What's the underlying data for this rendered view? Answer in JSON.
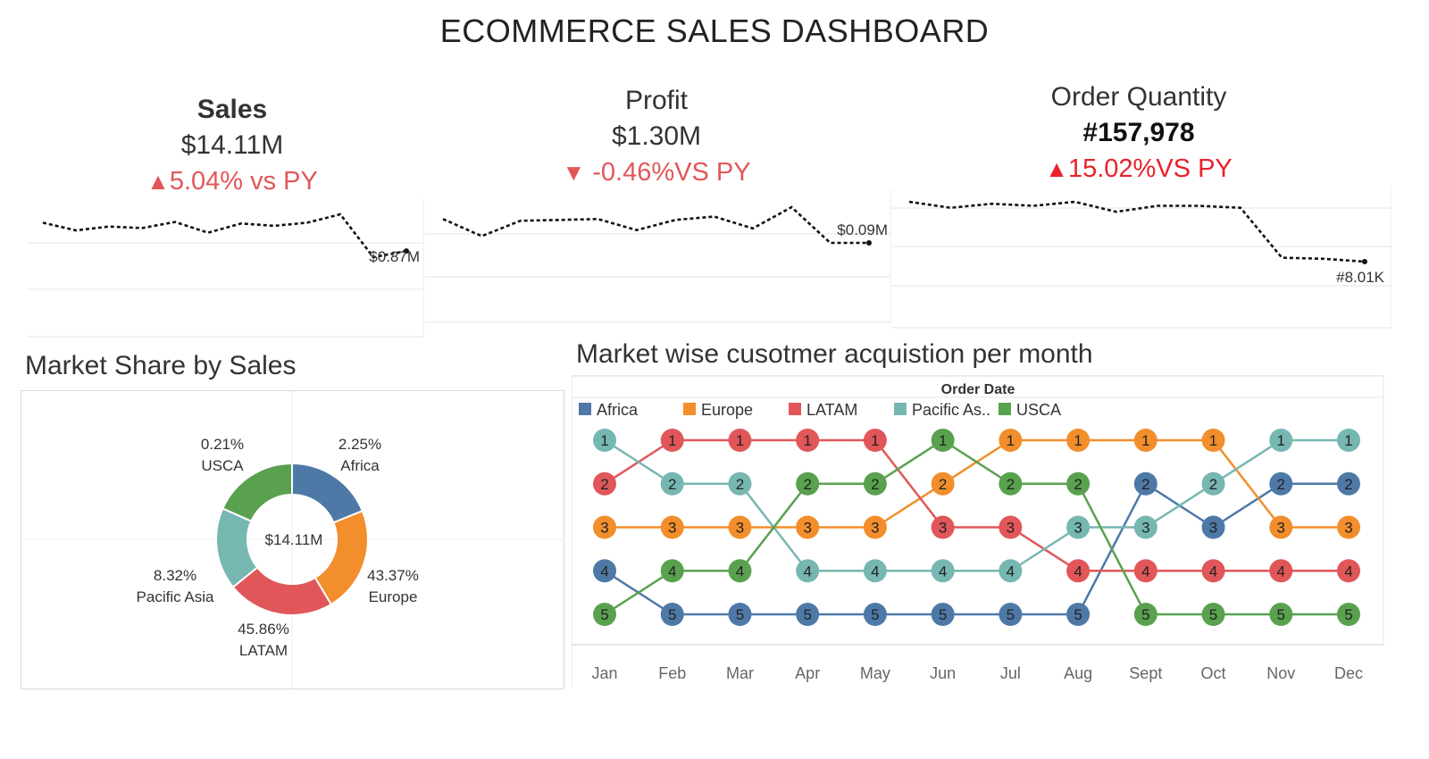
{
  "dashboard": {
    "title": "ECOMMERCE SALES DASHBOARD"
  },
  "kpis": {
    "sales": {
      "title": "Sales",
      "value": "$14.11M",
      "change": "5.04% vs PY",
      "arrow": "▲",
      "color": "#e15759"
    },
    "profit": {
      "title": "Profit",
      "value": "$1.30M",
      "change": "-0.46%VS PY",
      "arrow": "▼",
      "color": "#e15759"
    },
    "quantity": {
      "title": "Order Quantity",
      "value": "#157,978",
      "change": "15.02%VS PY",
      "arrow": "▲",
      "color": "#e8212b"
    }
  },
  "sections": {
    "market_share": {
      "title": "Market Share by Sales"
    },
    "acquisition": {
      "title": "Market wise cusotmer acquistion per month"
    }
  },
  "chart_data": [
    {
      "type": "line",
      "id": "sales-sparkline",
      "x": [
        "Jan",
        "Feb",
        "Mar",
        "Apr",
        "May",
        "Jun",
        "Jul",
        "Aug",
        "Sept",
        "Oct",
        "Nov",
        "Dec"
      ],
      "values": [
        1.24,
        1.14,
        1.19,
        1.17,
        1.25,
        1.11,
        1.23,
        1.2,
        1.24,
        1.35,
        0.79,
        0.87
      ],
      "end_label": "$0.87M",
      "grid": true
    },
    {
      "type": "line",
      "id": "profit-sparkline",
      "x": [
        "Jan",
        "Feb",
        "Mar",
        "Apr",
        "May",
        "Jun",
        "Jul",
        "Aug",
        "Sept",
        "Oct",
        "Nov",
        "Dec"
      ],
      "values": [
        0.118,
        0.098,
        0.116,
        0.117,
        0.118,
        0.105,
        0.117,
        0.121,
        0.107,
        0.132,
        0.09,
        0.09
      ],
      "end_label": "$0.09M",
      "grid": true
    },
    {
      "type": "line",
      "id": "quantity-sparkline",
      "x": [
        "Jan",
        "Feb",
        "Mar",
        "Apr",
        "May",
        "Jun",
        "Jul",
        "Aug",
        "Sept",
        "Oct",
        "Nov",
        "Dec"
      ],
      "values": [
        14.0,
        13.4,
        13.8,
        13.6,
        14.0,
        13.0,
        13.6,
        13.6,
        13.4,
        8.4,
        8.3,
        8.01
      ],
      "end_label": "#8.01K",
      "grid": true
    },
    {
      "type": "pie",
      "id": "market-share-donut",
      "center_label": "$14.11M",
      "slices": [
        {
          "name": "Africa",
          "pct_label": "2.25%",
          "value": 2.25,
          "color": "#4e79a7"
        },
        {
          "name": "Europe",
          "pct_label": "43.37%",
          "value": 43.37,
          "color": "#f28e2b"
        },
        {
          "name": "LATAM",
          "pct_label": "45.86%",
          "value": 45.86,
          "color": "#e15759"
        },
        {
          "name": "Pacific Asia",
          "pct_label": "8.32%",
          "value": 8.32,
          "color": "#76b7b2"
        },
        {
          "name": "USCA",
          "pct_label": "0.21%",
          "value": 0.21,
          "color": "#59a14f"
        }
      ]
    },
    {
      "type": "line",
      "id": "acquisition-bump",
      "title": "Order Date",
      "x": [
        "Jan",
        "Feb",
        "Mar",
        "Apr",
        "May",
        "Jun",
        "Jul",
        "Aug",
        "Sept",
        "Oct",
        "Nov",
        "Dec"
      ],
      "ylim": [
        1,
        5
      ],
      "legend": "top-left",
      "series": [
        {
          "name": "Africa",
          "legend_label": "Africa",
          "color": "#4e79a7",
          "values": [
            4,
            5,
            5,
            5,
            5,
            5,
            5,
            5,
            2,
            3,
            2,
            2
          ]
        },
        {
          "name": "Europe",
          "legend_label": "Europe",
          "color": "#f28e2b",
          "values": [
            3,
            3,
            3,
            3,
            3,
            2,
            1,
            1,
            1,
            1,
            3,
            3
          ]
        },
        {
          "name": "LATAM",
          "legend_label": "LATAM",
          "color": "#e15759",
          "values": [
            2,
            1,
            1,
            1,
            1,
            3,
            3,
            4,
            4,
            4,
            4,
            4
          ]
        },
        {
          "name": "Pacific Asia",
          "legend_label": "Pacific As..",
          "color": "#76b7b2",
          "values": [
            1,
            2,
            2,
            4,
            4,
            4,
            4,
            3,
            3,
            2,
            1,
            1
          ]
        },
        {
          "name": "USCA",
          "legend_label": "USCA",
          "color": "#59a14f",
          "values": [
            5,
            4,
            4,
            2,
            2,
            1,
            2,
            2,
            5,
            5,
            5,
            5
          ]
        }
      ]
    }
  ]
}
